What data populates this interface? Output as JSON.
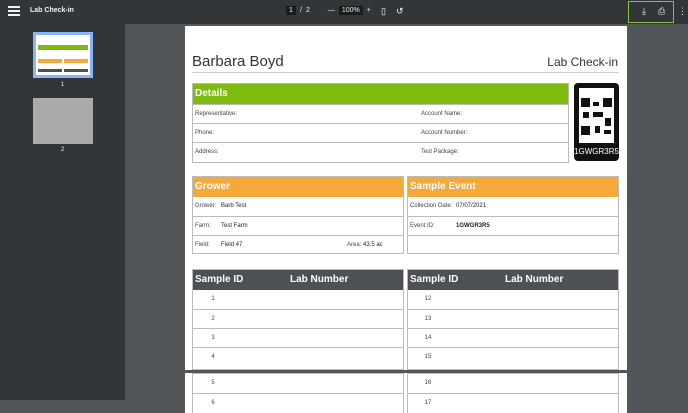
{
  "toolbar": {
    "title": "Lab Check-in",
    "page_current": "1",
    "page_sep": "/",
    "page_total": "2",
    "zoom_out": "—",
    "zoom": "100%",
    "zoom_in": "+",
    "fit_icon": "fit-page-icon",
    "rotate_icon": "rotate-icon",
    "download_icon": "download-icon",
    "print_icon": "print-icon",
    "more_icon": "more-icon"
  },
  "sidebar": {
    "thumbs": [
      {
        "label": "1"
      },
      {
        "label": "2"
      }
    ]
  },
  "document": {
    "name": "Barbara Boyd",
    "doc_title": "Lab Check-in",
    "details": {
      "title": "Details",
      "representative": "Representative:",
      "account_name": "Account Name:",
      "phone": "Phone:",
      "account_number": "Account Number:",
      "address": "Address:",
      "test_package": "Test Package:"
    },
    "qr_code": "1GWGR3R5",
    "grower": {
      "title": "Grower",
      "grower_label": "Grower:",
      "grower_value": "Barb Test",
      "farm_label": "Farm:",
      "farm_value": "Test Farm",
      "field_label": "Field:",
      "field_value": "Field 47",
      "area_label": "Area:",
      "area_value": "43.5 ac"
    },
    "sample_event": {
      "title": "Sample Event",
      "collection_label": "Collection Date:",
      "collection_value": "07/07/2021",
      "event_label": "Event ID:",
      "event_value": "1GWGR3R5"
    },
    "sample_table": {
      "col_sample_id": "Sample ID",
      "col_lab_number": "Lab Number",
      "left_rows": [
        "1",
        "2",
        "3",
        "4"
      ],
      "right_rows": [
        "12",
        "13",
        "14",
        "15"
      ],
      "left_rows_p2": [
        "5",
        "6"
      ],
      "right_rows_p2": [
        "16",
        "17"
      ]
    }
  }
}
